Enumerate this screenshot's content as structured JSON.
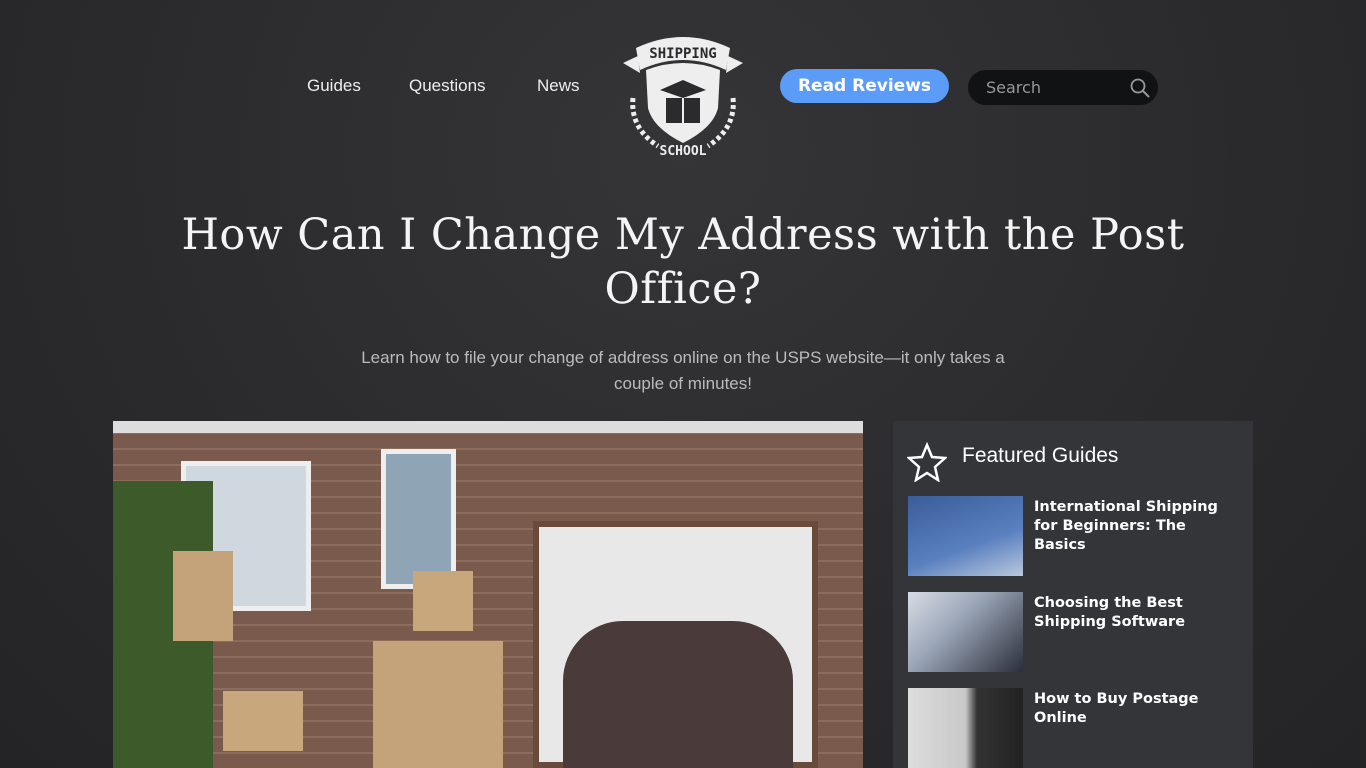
{
  "nav": {
    "items": [
      {
        "label": "Guides"
      },
      {
        "label": "Questions"
      },
      {
        "label": "News"
      }
    ],
    "logo_text": [
      "SHIPPING",
      "SCHOOL"
    ],
    "read_reviews": "Read Reviews",
    "search_placeholder": "Search"
  },
  "article": {
    "title": "How Can I Change My Address with the Post Office?",
    "subtitle": "Learn how to file your change of address online on the USPS website—it only takes a couple of minutes!"
  },
  "sidebar": {
    "title": "Featured Guides",
    "items": [
      {
        "title": "International Shipping for Beginners: The Basics"
      },
      {
        "title": "Choosing the Best Shipping Software"
      },
      {
        "title": "How to Buy Postage Online"
      }
    ]
  },
  "colors": {
    "accent": "#5b9cf8",
    "background": "#2b2b2d",
    "sidebar": "#333539"
  }
}
